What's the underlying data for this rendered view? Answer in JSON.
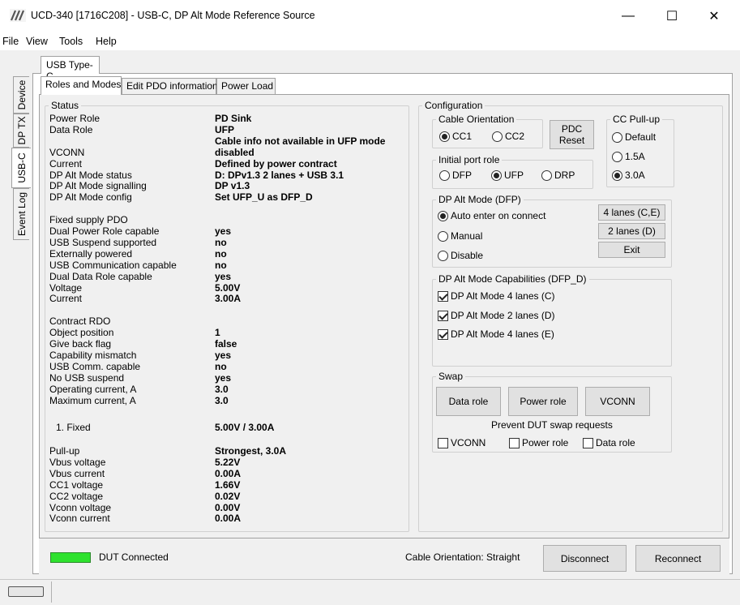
{
  "window": {
    "title": "UCD-340 [1716C208] - USB-C, DP Alt Mode Reference Source",
    "minimize": "—",
    "maximize": "☐",
    "close": "✕"
  },
  "menu": [
    "File",
    "View",
    "Tools",
    "Help"
  ],
  "side_tabs": [
    "Device",
    "DP TX",
    "USB-C",
    "Event Log"
  ],
  "outer_tab": "USB Type-C",
  "inner_tabs": [
    "Roles and Modes",
    "Edit PDO information",
    "Power Load"
  ],
  "status": {
    "title": "Status",
    "rows": [
      {
        "label": "Power Role",
        "value": "PD Sink"
      },
      {
        "label": "Data Role",
        "value": "UFP"
      },
      {
        "label": "",
        "value": "Cable info not available in UFP mode"
      },
      {
        "label": "VCONN",
        "value": "disabled"
      },
      {
        "label": "Current",
        "value": "Defined by power contract"
      },
      {
        "label": "DP Alt Mode status",
        "value": "D: DPv1.3 2 lanes + USB 3.1"
      },
      {
        "label": "DP Alt Mode signalling",
        "value": "DP v1.3"
      },
      {
        "label": "DP Alt Mode config",
        "value": "Set UFP_U as DFP_D"
      },
      {
        "label": "",
        "value": ""
      },
      {
        "label": "Fixed supply PDO",
        "value": ""
      },
      {
        "label": "Dual Power Role capable",
        "value": "yes"
      },
      {
        "label": "USB Suspend supported",
        "value": "no"
      },
      {
        "label": "Externally powered",
        "value": "no"
      },
      {
        "label": "USB Communication capable",
        "value": "no"
      },
      {
        "label": "Dual Data Role capable",
        "value": "yes"
      },
      {
        "label": "Voltage",
        "value": "5.00V"
      },
      {
        "label": "Current",
        "value": "3.00A"
      },
      {
        "label": "",
        "value": ""
      },
      {
        "label": "Contract RDO",
        "value": ""
      },
      {
        "label": "Object position",
        "value": "1"
      },
      {
        "label": "Give back flag",
        "value": "false"
      },
      {
        "label": "Capability mismatch",
        "value": "yes"
      },
      {
        "label": "USB Comm. capable",
        "value": "no"
      },
      {
        "label": "No USB suspend",
        "value": "yes"
      },
      {
        "label": "Operating current, A",
        "value": "3.0"
      },
      {
        "label": "Maximum current, A",
        "value": "3.0"
      }
    ],
    "fixed_label": "1. Fixed",
    "fixed_value": "5.00V / 3.00A",
    "rows2": [
      {
        "label": "Pull-up",
        "value": "Strongest, 3.0A"
      },
      {
        "label": "Vbus voltage",
        "value": "5.22V"
      },
      {
        "label": "Vbus current",
        "value": "0.00A"
      },
      {
        "label": "CC1 voltage",
        "value": "1.66V"
      },
      {
        "label": "CC2 voltage",
        "value": "0.02V"
      },
      {
        "label": "Vconn voltage",
        "value": "0.00V"
      },
      {
        "label": "Vconn current",
        "value": "0.00A"
      }
    ]
  },
  "config": {
    "title": "Configuration",
    "cable_orientation": {
      "title": "Cable Orientation",
      "cc1": "CC1",
      "cc2": "CC2",
      "selected": "CC1"
    },
    "pdc_reset": "PDC Reset",
    "cc_pullup": {
      "title": "CC Pull-up",
      "options": [
        "Default",
        "1.5A",
        "3.0A"
      ],
      "selected": "3.0A"
    },
    "initial_port_role": {
      "title": "Initial port role",
      "options": [
        "DFP",
        "UFP",
        "DRP"
      ],
      "selected": "UFP"
    },
    "dp_alt_mode": {
      "title": "DP Alt Mode (DFP)",
      "options": [
        "Auto enter on connect",
        "Manual",
        "Disable"
      ],
      "selected": "Auto enter on connect",
      "buttons": [
        "4 lanes (C,E)",
        "2 lanes (D)",
        "Exit"
      ]
    },
    "dp_caps": {
      "title": "DP Alt Mode Capabilities (DFP_D)",
      "items": [
        {
          "label": "DP Alt Mode 4 lanes (C)",
          "checked": true
        },
        {
          "label": "DP Alt Mode 2 lanes (D)",
          "checked": true
        },
        {
          "label": "DP Alt Mode 4 lanes (E)",
          "checked": true
        }
      ]
    },
    "swap": {
      "title": "Swap",
      "buttons": [
        "Data role",
        "Power role",
        "VCONN"
      ],
      "prevent_label": "Prevent DUT swap requests",
      "checks": [
        {
          "label": "VCONN",
          "checked": false
        },
        {
          "label": "Power role",
          "checked": false
        },
        {
          "label": "Data role",
          "checked": false
        }
      ]
    }
  },
  "footer": {
    "dut_status": "DUT Connected",
    "led_color": "#2ee22e",
    "cable_orientation_text": "Cable Orientation: Straight",
    "disconnect": "Disconnect",
    "reconnect": "Reconnect"
  }
}
